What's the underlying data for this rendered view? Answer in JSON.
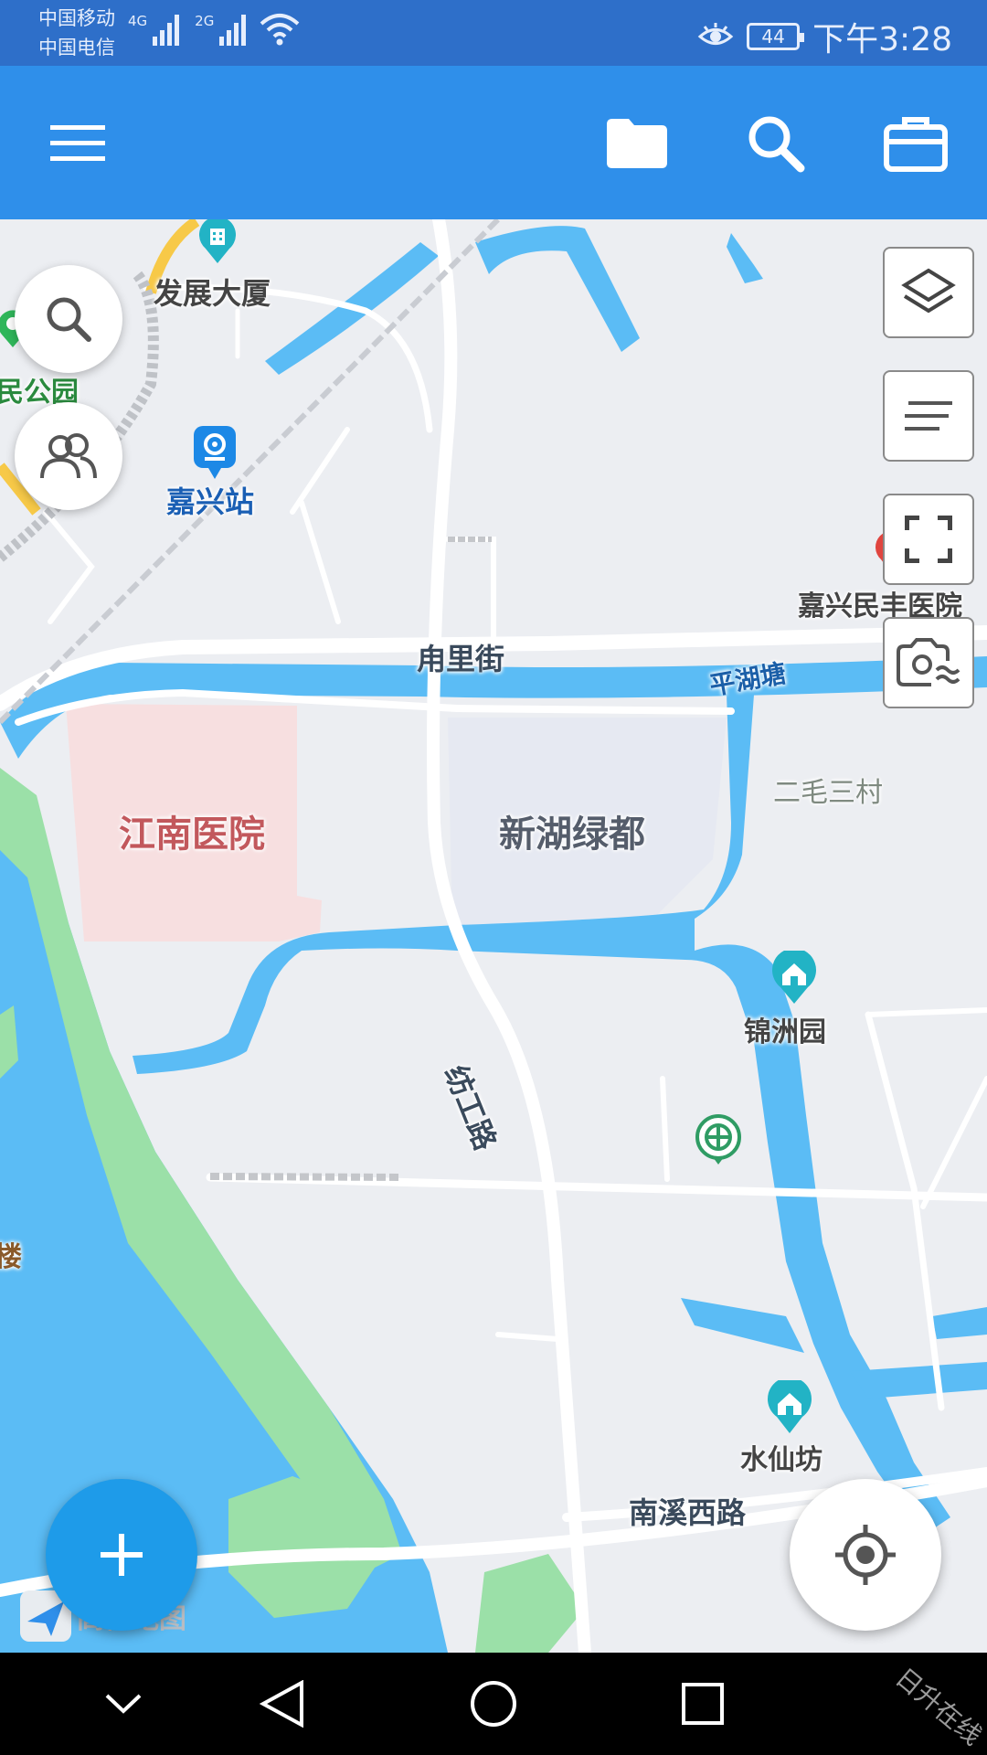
{
  "status_bar": {
    "carrier_1": "中国移动",
    "carrier_2": "中国电信",
    "net_1": "4G",
    "net_2": "2G",
    "battery": "44",
    "time": "下午3:28"
  },
  "app_bar": {
    "icons": [
      "menu-icon",
      "folder-icon",
      "search-icon",
      "toolbox-icon"
    ]
  },
  "map": {
    "labels": {
      "fazhan": "发展大厦",
      "jiaxing_station": "嘉兴站",
      "park": "民公园",
      "minfeng_hospital": "嘉兴民丰医院",
      "yongli_street": "甪里街",
      "pinghu_tang": "平湖塘",
      "ermao_sancun": "二毛三村",
      "jiangnan_hospital": "江南医院",
      "xinhu_ludu": "新湖绿都",
      "jinzhou_yuan": "锦洲园",
      "fangong_road": "纺工路",
      "lou": "楼",
      "shuixian_fang": "水仙坊",
      "nanxi_west_road": "南溪西路",
      "logo_text": "高德地图"
    },
    "colors": {
      "water": "#5bbcf5",
      "green": "#9be0a8",
      "hospital_area": "#f7dfe0",
      "residential_area": "#e6e9f2",
      "road": "#ffffff"
    }
  },
  "nav_bar": {
    "icons": [
      "back-chevron-icon",
      "back-triangle-icon",
      "home-circle-icon",
      "recents-square-icon"
    ]
  },
  "watermark": "日升在线"
}
